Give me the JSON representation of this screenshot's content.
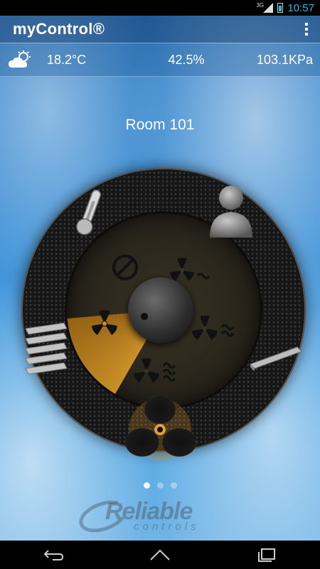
{
  "status_bar": {
    "network": "3G",
    "time": "10:57"
  },
  "app": {
    "title": "myControl®"
  },
  "weather": {
    "icon": "partly-cloudy-icon",
    "temperature": "18.2°C",
    "humidity": "42.5%",
    "pressure": "103.1KPa"
  },
  "room": {
    "name": "Room 101"
  },
  "dial": {
    "modes": [
      "off",
      "fan-low",
      "fan-medium",
      "fan-high",
      "fan-auto"
    ],
    "selected_mode": "fan-low",
    "side_icons": [
      "thermometer-icon",
      "occupant-icon",
      "louver-icon",
      "damper-icon",
      "fan-icon"
    ]
  },
  "pager": {
    "pages": 3,
    "current": 1
  },
  "brand": {
    "name": "Reliable",
    "sub": "controls"
  },
  "colors": {
    "accent": "#33b5e5",
    "selected_sector": "#d29628",
    "sky": "#3c8fd6"
  }
}
